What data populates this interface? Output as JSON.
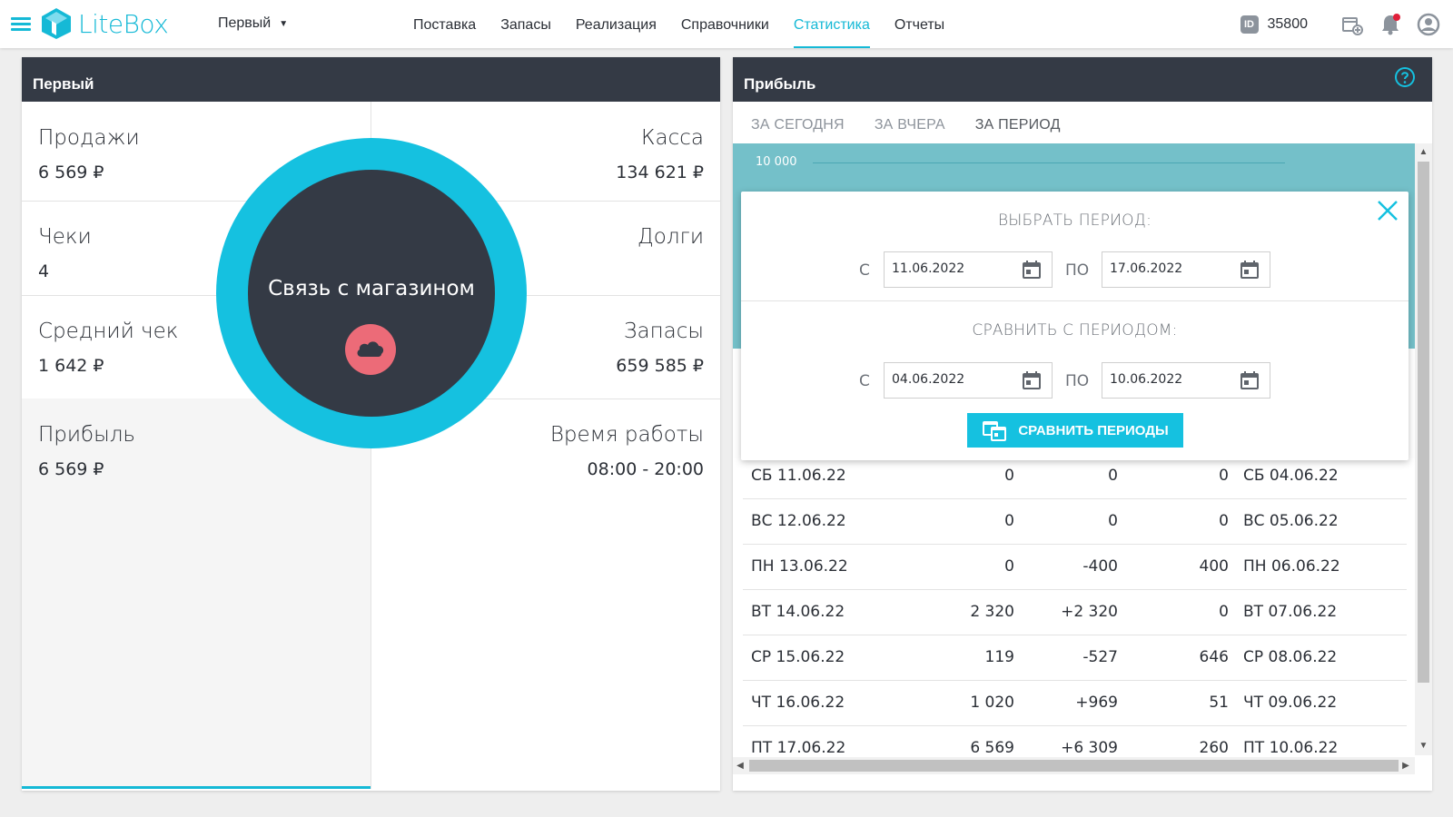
{
  "app": {
    "logo_text": "LiteBox",
    "accent": "#15b9d6",
    "dark": "#343a45",
    "alert": "#ec6b78"
  },
  "header": {
    "store_select": "Первый",
    "nav": [
      "Поставка",
      "Запасы",
      "Реализация",
      "Справочники",
      "Статистика",
      "Отчеты"
    ],
    "active_nav": "Статистика",
    "id_label": "ID",
    "id_value": "35800",
    "icons": [
      "menu-icon",
      "add-store-icon",
      "notifications-icon",
      "account-icon"
    ]
  },
  "store_panel": {
    "title": "Первый",
    "sales": {
      "label": "Продажи",
      "value": "6 569 ₽"
    },
    "cash": {
      "label": "Касса",
      "value": "134 621 ₽"
    },
    "checks": {
      "label": "Чеки",
      "value": "4"
    },
    "debts": {
      "label": "Долги",
      "value": ""
    },
    "avg_check": {
      "label": "Средний чек",
      "value": "1 642 ₽"
    },
    "stock": {
      "label": "Запасы",
      "value": "659 585 ₽"
    },
    "profit": {
      "label": "Прибыль",
      "value": "6 569 ₽"
    },
    "work_time": {
      "label": "Время работы",
      "value": "08:00 - 20:00"
    },
    "connection": {
      "text": "Связь с магазином",
      "icon": "cloud-icon"
    }
  },
  "profit_panel": {
    "title": "Прибыль",
    "tabs": [
      "ЗА СЕГОДНЯ",
      "ЗА ВЧЕРА",
      "ЗА ПЕРИОД"
    ],
    "active_tab": "ЗА ПЕРИОД",
    "chart_axis_label": "10 000",
    "modal": {
      "select_title": "ВЫБРАТЬ ПЕРИОД:",
      "compare_title": "СРАВНИТЬ С ПЕРИОДОМ:",
      "from_label": "С",
      "to_label": "ПО",
      "period_from": "11.06.2022",
      "period_to": "17.06.2022",
      "compare_from": "04.06.2022",
      "compare_to": "10.06.2022",
      "compare_button": "СРАВНИТЬ ПЕРИОДЫ"
    },
    "rows": [
      {
        "date": "СБ 11.06.22",
        "value": "0",
        "diff": "0",
        "prev": "0",
        "prev_date": "СБ 04.06.22"
      },
      {
        "date": "ВС 12.06.22",
        "value": "0",
        "diff": "0",
        "prev": "0",
        "prev_date": "ВС 05.06.22"
      },
      {
        "date": "ПН 13.06.22",
        "value": "0",
        "diff": "-400",
        "prev": "400",
        "prev_date": "ПН 06.06.22"
      },
      {
        "date": "ВТ 14.06.22",
        "value": "2 320",
        "diff": "+2 320",
        "prev": "0",
        "prev_date": "ВТ 07.06.22"
      },
      {
        "date": "СР 15.06.22",
        "value": "119",
        "diff": "-527",
        "prev": "646",
        "prev_date": "СР 08.06.22"
      },
      {
        "date": "ЧТ 16.06.22",
        "value": "1 020",
        "diff": "+969",
        "prev": "51",
        "prev_date": "ЧТ 09.06.22"
      },
      {
        "date": "ПТ 17.06.22",
        "value": "6 569",
        "diff": "+6 309",
        "prev": "260",
        "prev_date": "ПТ 10.06.22"
      }
    ]
  }
}
